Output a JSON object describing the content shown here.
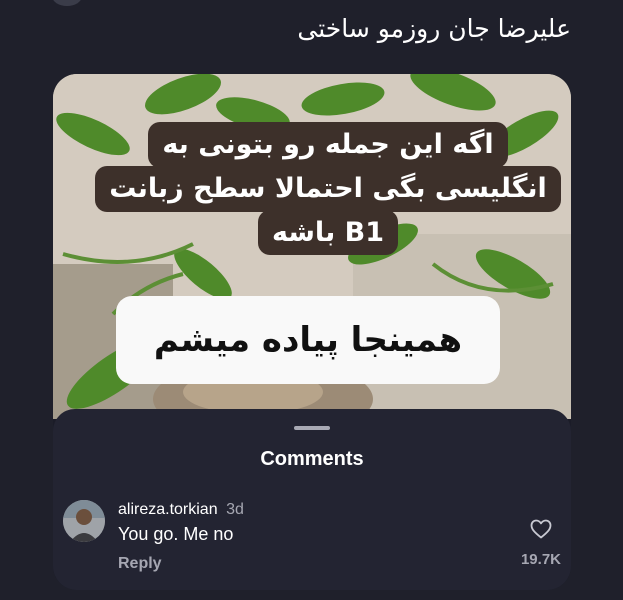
{
  "caption": "علیرضا جان روزمو ساختی",
  "post": {
    "banner_lines": [
      "اگه این جمله رو بتونی به",
      "انگلیسی بگی احتمالا سطح زبانت",
      "B1 باشه"
    ],
    "punchline": "همینجا پیاده میشم"
  },
  "comments_sheet": {
    "title": "Comments",
    "comment": {
      "username": "alireza.torkian",
      "time": "3d",
      "text": "You go. Me no",
      "reply_label": "Reply",
      "likes": "19.7K"
    }
  },
  "icons": {
    "like": "heart-icon"
  },
  "colors": {
    "background": "#1f202b",
    "sheet": "#232432",
    "banner_dark": "#3d302a",
    "banner_light": "#f9f9f9",
    "muted_text": "#a6a7b2"
  }
}
